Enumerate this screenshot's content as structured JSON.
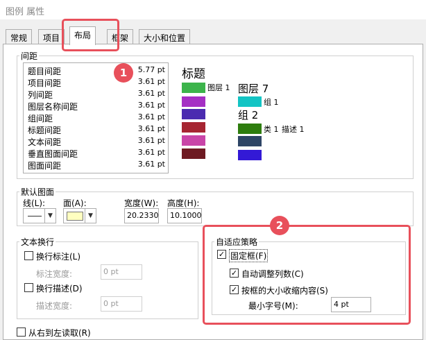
{
  "window": {
    "title": "图例 属性"
  },
  "tabs": [
    {
      "label": "常规"
    },
    {
      "label": "项目"
    },
    {
      "label": "布局"
    },
    {
      "label": "框架"
    },
    {
      "label": "大小和位置"
    }
  ],
  "spacing": {
    "title": "间距",
    "items": [
      {
        "label": "题目间距",
        "value": "5.77 pt"
      },
      {
        "label": "项目间距",
        "value": "3.61 pt"
      },
      {
        "label": "列间距",
        "value": "3.61 pt"
      },
      {
        "label": "图层名称间距",
        "value": "3.61 pt"
      },
      {
        "label": "组间距",
        "value": "3.61 pt"
      },
      {
        "label": "标题间距",
        "value": "3.61 pt"
      },
      {
        "label": "文本间距",
        "value": "3.61 pt"
      },
      {
        "label": "垂直图面间距",
        "value": "3.61 pt"
      },
      {
        "label": "图面间距",
        "value": "3.61 pt"
      }
    ]
  },
  "preview": {
    "title": "标题",
    "layer1": "图层 1",
    "layer7": "图层 7",
    "group1": "组 1",
    "group2": "组 2",
    "class1": "类 1",
    "desc1": "描述 1",
    "colors": [
      "#3cb44b",
      "#a52fc4",
      "#4b2bb0",
      "#a62532",
      "#c945a8",
      "#6e1a22",
      "#13c4c4",
      "#2e7d0e",
      "#2e4566",
      "#3319d6"
    ]
  },
  "default_patch": {
    "title": "默认图面",
    "line_label": "线(L):",
    "area_label": "面(A):",
    "width_label": "宽度(W):",
    "width_value": "20.2330",
    "height_label": "高度(H):",
    "height_value": "10.1000",
    "area_color": "#ffffc0"
  },
  "text_wrap": {
    "title": "文本换行",
    "wrap_label": "换行标注(L)",
    "label_width": "标注宽度:",
    "label_width_value": "0 pt",
    "wrap_desc": "换行描述(D)",
    "desc_width": "描述宽度:",
    "desc_width_value": "0 pt"
  },
  "adaptive": {
    "title": "自适应策略",
    "fixed_frame": "固定框(F)",
    "auto_columns": "自动调整列数(C)",
    "shrink": "按框的大小收缩内容(S)",
    "min_font_label": "最小字号(M):",
    "min_font_value": "4 pt",
    "check": "✓"
  },
  "rtl": {
    "label": "从右到左读取(R)"
  },
  "annotations": {
    "badge1": "1",
    "badge2": "2",
    "accent": "#e8505b"
  },
  "icons": {
    "dropdown": "▼"
  }
}
